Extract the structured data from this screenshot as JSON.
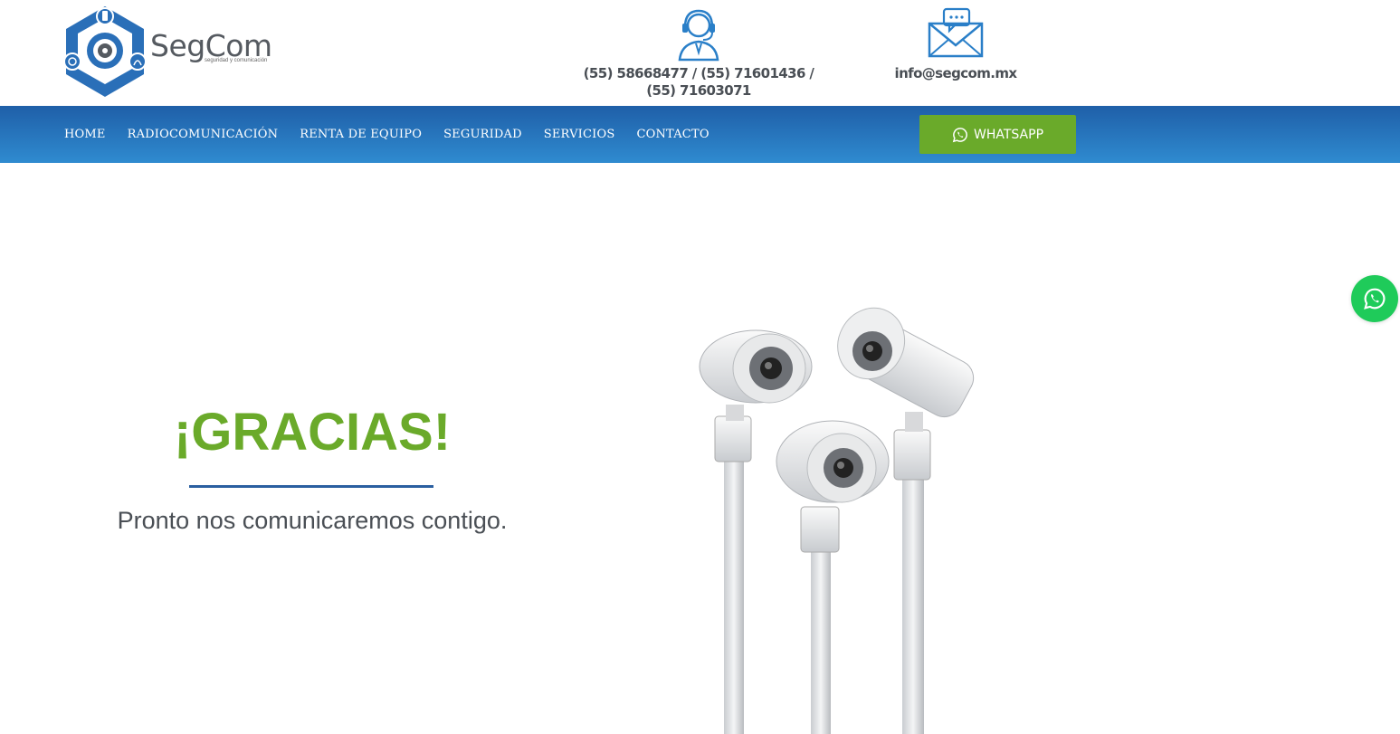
{
  "header": {
    "logo": {
      "name": "SegCom",
      "tagline": "seguridad y comunicación"
    },
    "phone": {
      "icon": "headset-agent-icon",
      "numbers": "(55) 58668477 / (55) 71601436 / (55) 71603071"
    },
    "email": {
      "icon": "envelope-chat-icon",
      "address": "info@segcom.mx"
    }
  },
  "nav": {
    "items": [
      {
        "label": "HOME"
      },
      {
        "label": "RADIOCOMUNICACIÓN"
      },
      {
        "label": "RENTA DE EQUIPO"
      },
      {
        "label": "SEGURIDAD"
      },
      {
        "label": "SERVICIOS"
      },
      {
        "label": "CONTACTO"
      }
    ],
    "whatsapp_button": {
      "label": "WHATSAPP",
      "icon": "whatsapp-icon"
    }
  },
  "main": {
    "title": "¡GRACIAS!",
    "subtitle": "Pronto nos comunicaremos contigo."
  },
  "floating": {
    "icon": "whatsapp-icon"
  },
  "colors": {
    "brand_blue": "#2a6fb8",
    "accent_green": "#6aaa2a",
    "whatsapp_green": "#1fcb5a",
    "text_gray": "#4a4f55"
  }
}
